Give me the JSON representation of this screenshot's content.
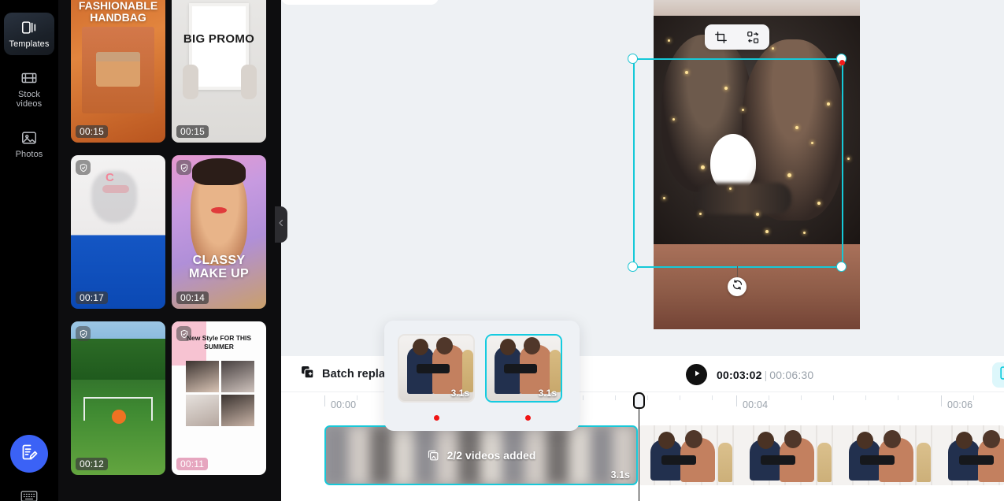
{
  "sidebar": {
    "items": [
      {
        "label": "Templates",
        "icon": "templates-icon",
        "active": true
      },
      {
        "label": "Stock videos",
        "icon": "film-strip-icon",
        "active": false
      },
      {
        "label": "Photos",
        "icon": "photo-icon",
        "active": false
      }
    ],
    "fab_icon": "document-edit-icon",
    "keyboard_icon": "keyboard-icon"
  },
  "templates": {
    "collapse_icon": "chevron-left-icon",
    "shield_icon": "shield-check-icon",
    "cards": [
      {
        "duration": "00:15",
        "title": "FASHIONABLE HANDBAG",
        "shield": false
      },
      {
        "duration": "00:15",
        "title": "BIG PROMO",
        "shield": false
      },
      {
        "duration": "00:17",
        "title": "",
        "shield": true
      },
      {
        "duration": "00:14",
        "title": "CLASSY MAKE UP",
        "shield": true
      },
      {
        "duration": "00:12",
        "title": "",
        "shield": true
      },
      {
        "duration": "00:11",
        "title": "New Style FOR THIS SUMMER",
        "shield": true
      }
    ]
  },
  "canvas": {
    "toolbar": {
      "crop_label": "crop-icon",
      "replace_label": "replace-media-icon"
    },
    "rotate_handle": "rotate-icon",
    "selection_color": "#15c9d8"
  },
  "timeline": {
    "batch_replace_label": "Batch replac",
    "batch_replace_icon": "batch-replace-icon",
    "play_icon": "play-icon",
    "current_time": "00:03:02",
    "time_separator": "|",
    "total_time": "00:06:30",
    "corner_icon": "aspect-ratio-icon",
    "ruler_labels": [
      "00:00",
      "00:04",
      "00:06"
    ],
    "clip": {
      "overlay_text": "2/2 videos added",
      "overlay_icon": "stacked-media-icon",
      "duration": "3.1s"
    }
  },
  "popup": {
    "thumbs": [
      {
        "duration": "3.1s",
        "selected": false
      },
      {
        "duration": "3.1s",
        "selected": true
      }
    ]
  }
}
